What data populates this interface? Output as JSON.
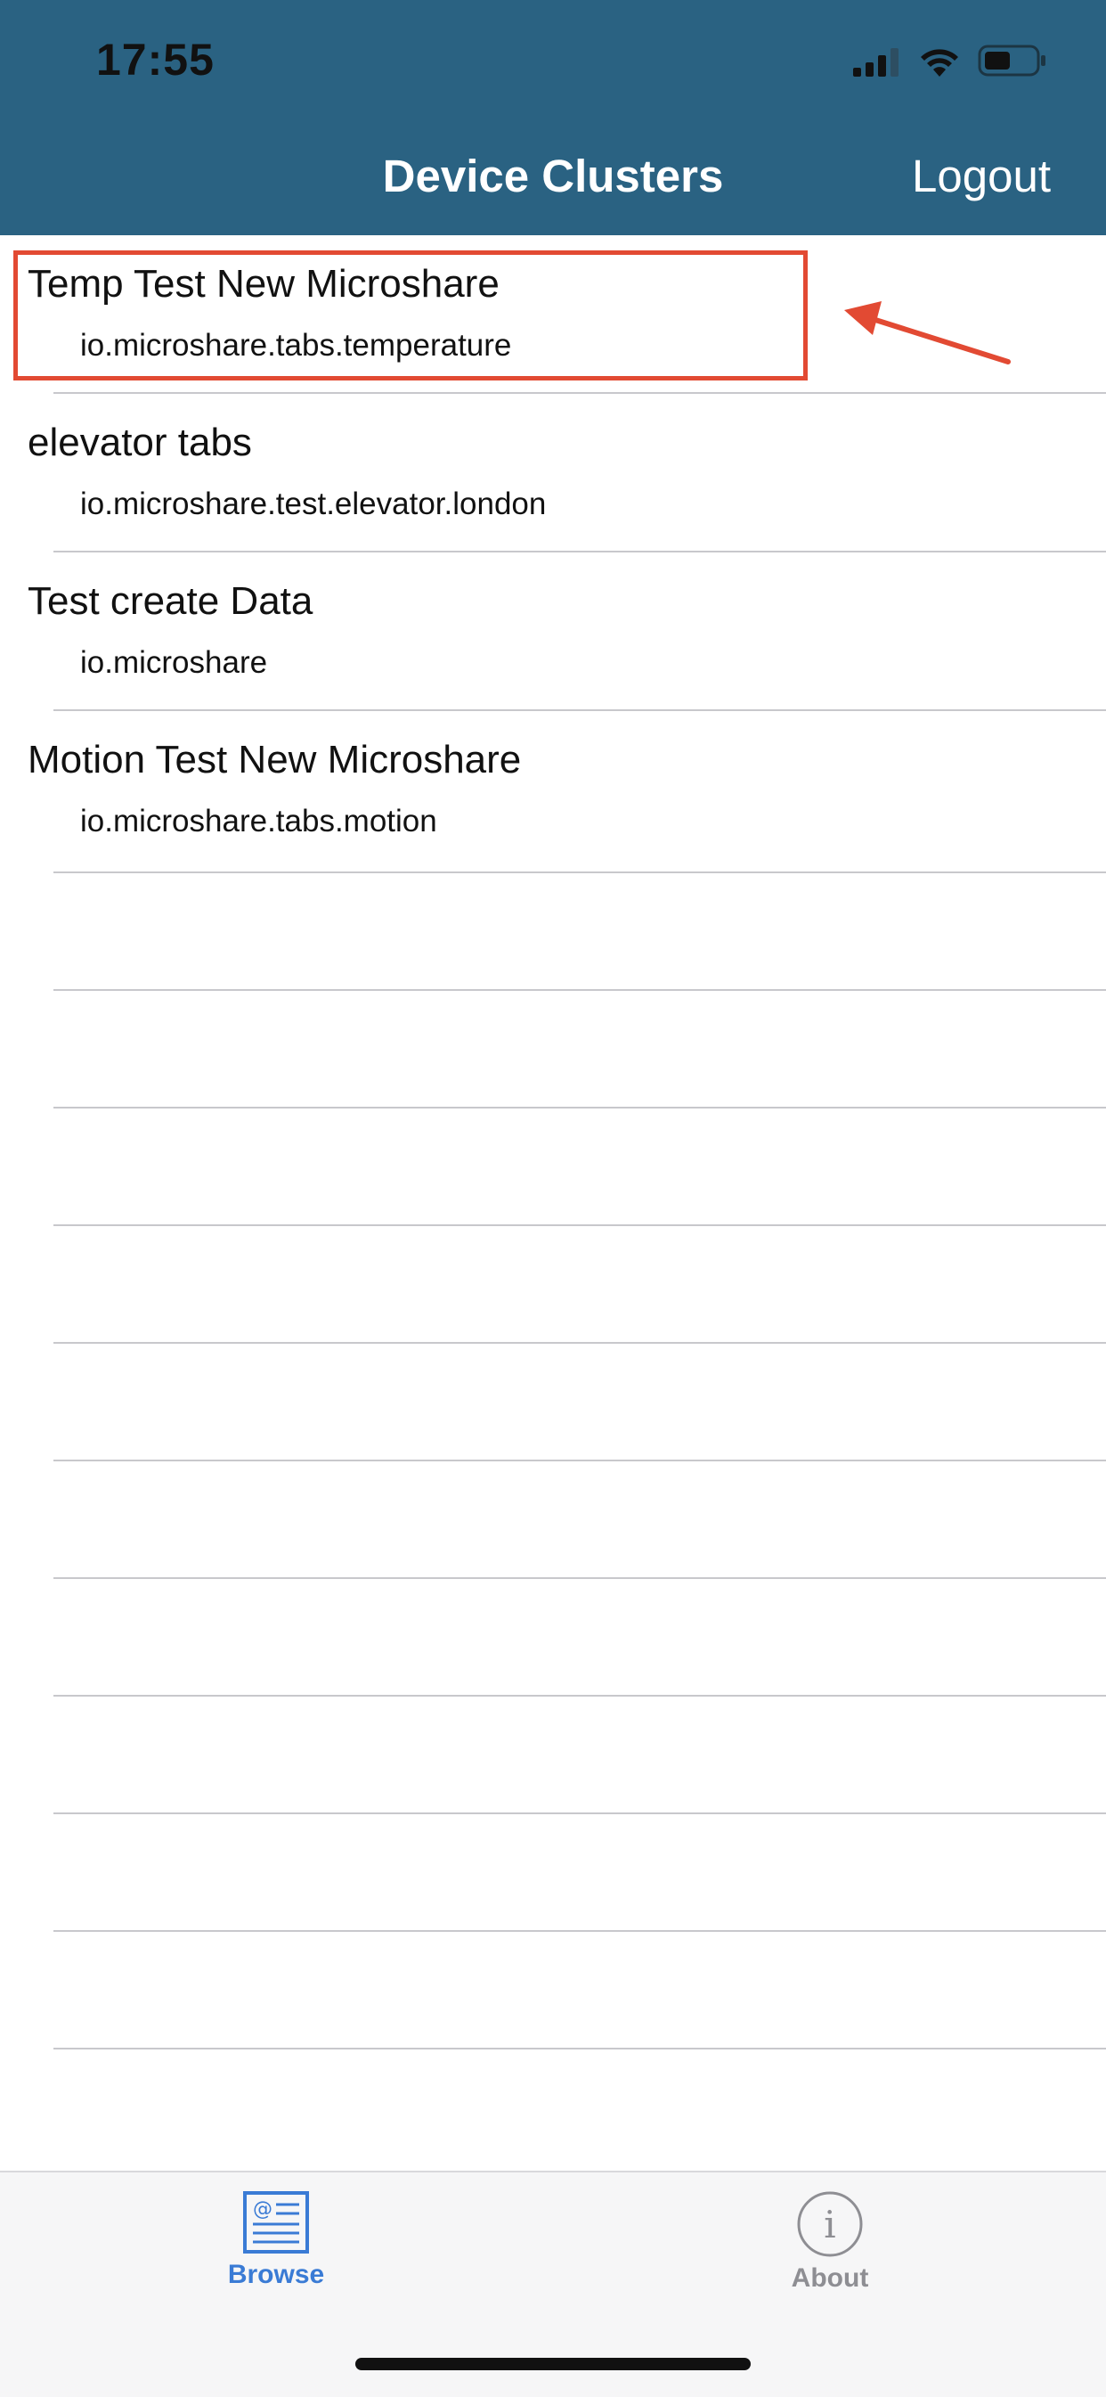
{
  "status_bar": {
    "time": "17:55"
  },
  "nav": {
    "title": "Device Clusters",
    "logout_label": "Logout"
  },
  "clusters": [
    {
      "title": "Temp Test New Microshare",
      "subtitle": "io.microshare.tabs.temperature"
    },
    {
      "title": "elevator tabs",
      "subtitle": "io.microshare.test.elevator.london"
    },
    {
      "title": "Test create Data",
      "subtitle": "io.microshare"
    },
    {
      "title": "Motion Test New Microshare",
      "subtitle": "io.microshare.tabs.motion"
    }
  ],
  "tabbar": {
    "browse_label": "Browse",
    "about_label": "About"
  },
  "colors": {
    "header": "#2a6282",
    "highlight": "#e24a33",
    "active_tab": "#3a7bd5",
    "inactive_tab": "#8e8e93"
  },
  "icons": {
    "browse": "browse-list-icon",
    "about": "info-icon"
  }
}
